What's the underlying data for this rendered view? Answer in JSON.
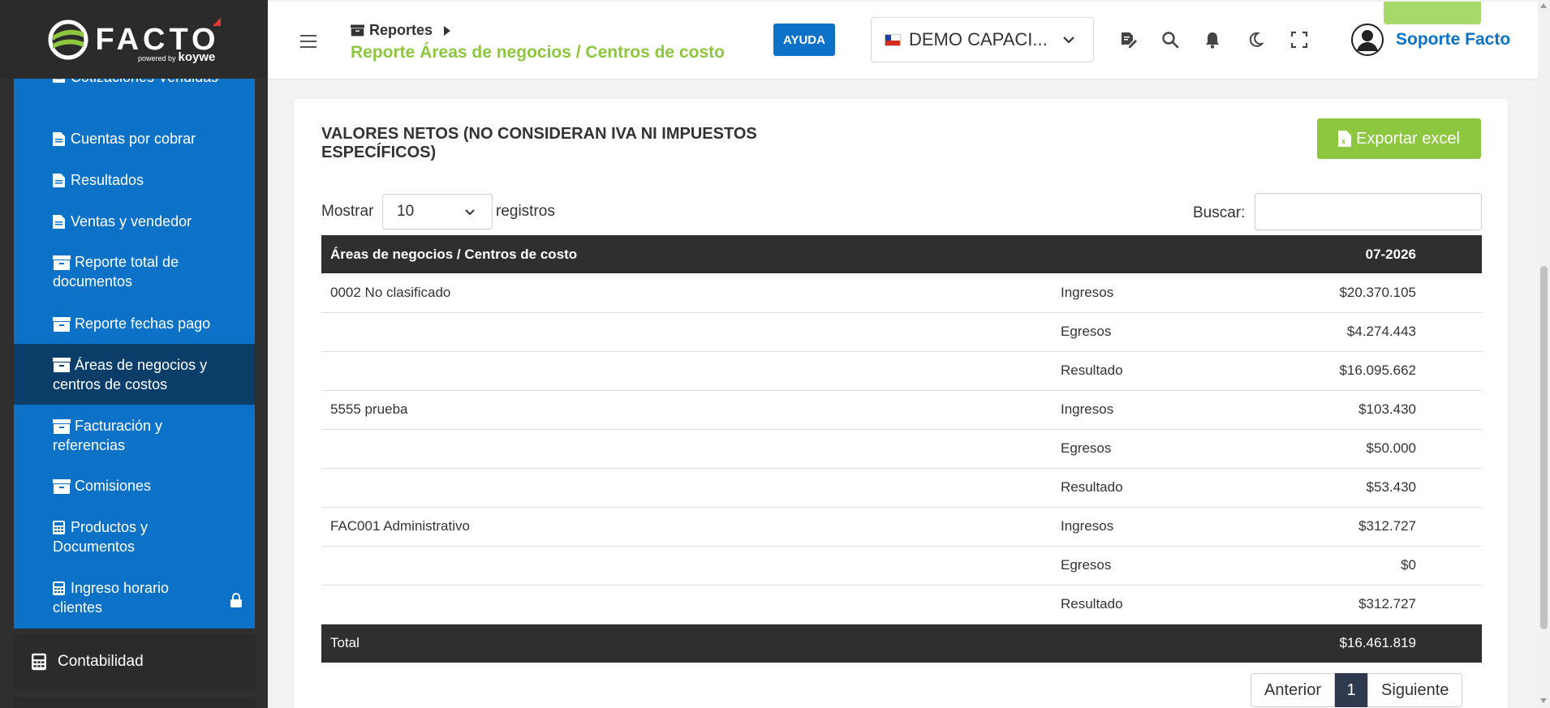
{
  "brand": {
    "name": "FACTO",
    "powered": "powered by",
    "powered_brand": "koywe"
  },
  "sidebar": {
    "items": [
      {
        "label": "Cotizaciones Vendidas",
        "icon": "document-icon"
      },
      {
        "label": "Cuentas por cobrar",
        "icon": "document-icon"
      },
      {
        "label": "Resultados",
        "icon": "document-icon"
      },
      {
        "label": "Ventas y vendedor",
        "icon": "document-icon"
      },
      {
        "label": "Reporte total de documentos",
        "icon": "archive-icon"
      },
      {
        "label": "Reporte fechas pago",
        "icon": "archive-icon"
      },
      {
        "label": "Áreas de negocios y centros de costos",
        "icon": "archive-icon",
        "active": true
      },
      {
        "label": "Facturación y referencias",
        "icon": "archive-icon"
      },
      {
        "label": "Comisiones",
        "icon": "archive-icon"
      },
      {
        "label": "Productos y Documentos",
        "icon": "calculator-icon"
      },
      {
        "label": "Ingreso horario clientes",
        "icon": "calculator-icon",
        "locked": true
      }
    ],
    "section": "Contabilidad"
  },
  "header": {
    "breadcrumb": "Reportes",
    "title": "Reporte Áreas de negocios / Centros de costo",
    "help_label": "AYUDA",
    "company": "DEMO CAPACI...",
    "user": "Soporte Facto"
  },
  "report": {
    "title": "VALORES NETOS (NO CONSIDERAN IVA NI IMPUESTOS ESPECÍFICOS)",
    "export_label": "Exportar excel",
    "length_prefix": "Mostrar",
    "length_value": "10",
    "length_suffix": "registros",
    "search_label": "Buscar:",
    "search_value": "",
    "columns": [
      "Áreas de negocios / Centros de costo",
      "",
      "07-2026"
    ],
    "rows": [
      [
        "0002 No clasificado",
        "Ingresos",
        "$20.370.105"
      ],
      [
        "",
        "Egresos",
        "$4.274.443"
      ],
      [
        "",
        "Resultado",
        "$16.095.662"
      ],
      [
        "5555 prueba",
        "Ingresos",
        "$103.430"
      ],
      [
        "",
        "Egresos",
        "$50.000"
      ],
      [
        "",
        "Resultado",
        "$53.430"
      ],
      [
        "FAC001 Administrativo",
        "Ingresos",
        "$312.727"
      ],
      [
        "",
        "Egresos",
        "$0"
      ],
      [
        "",
        "Resultado",
        "$312.727"
      ]
    ],
    "total_label": "Total",
    "total_value": "$16.461.819"
  },
  "pagination": {
    "prev": "Anterior",
    "current": "1",
    "next": "Siguiente"
  },
  "colors": {
    "primary_blue": "#0b72c7",
    "active_blue": "#0a3e69",
    "green": "#8dc63f",
    "dark": "#2f2f2f"
  }
}
